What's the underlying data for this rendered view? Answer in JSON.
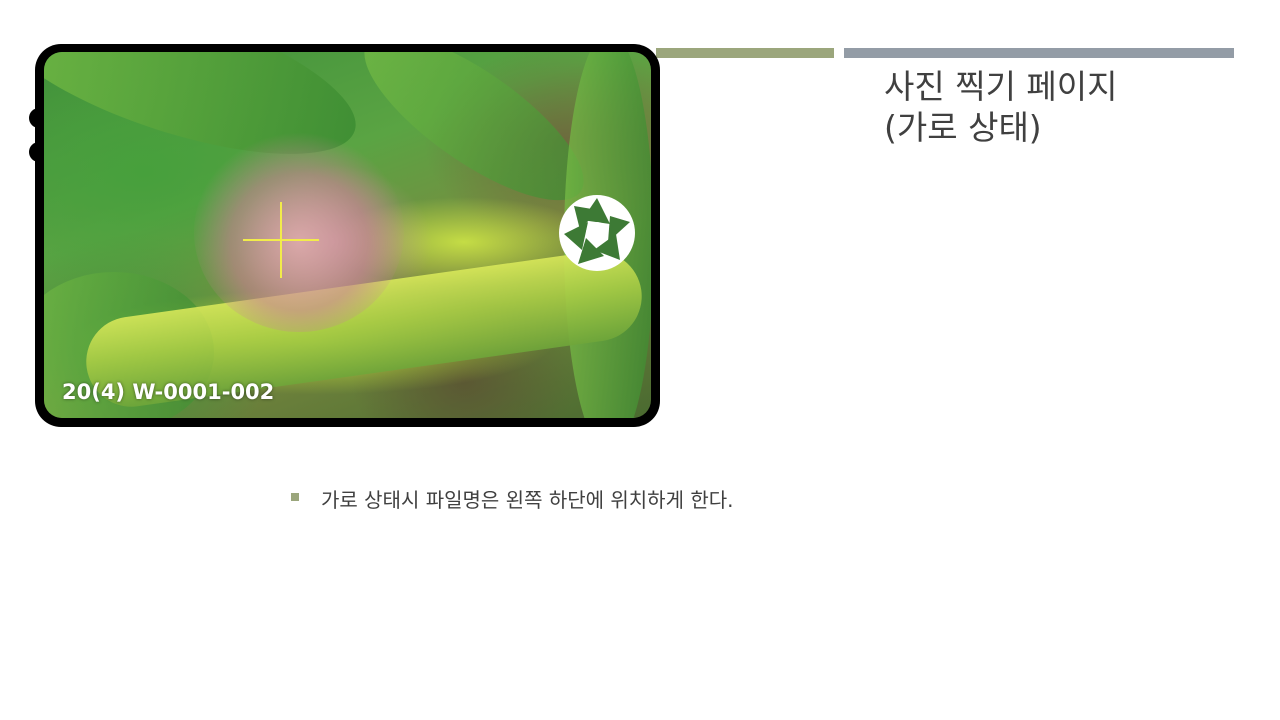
{
  "slide": {
    "title_line1": "사진 찍기 페이지",
    "title_line2": "(가로 상태)",
    "bullet": "가로 상태시 파일명은 왼쪽 하단에 위치하게 한다."
  },
  "camera_screen": {
    "filename": "20(4) W-0001-002",
    "shutter_icon": "shutter-aperture-icon",
    "focus_icon": "crosshair-icon"
  },
  "colors": {
    "accent_green": "#9ba67c",
    "accent_gray": "#939ca6",
    "crosshair": "#f2ec4a",
    "title_text": "#404040"
  }
}
